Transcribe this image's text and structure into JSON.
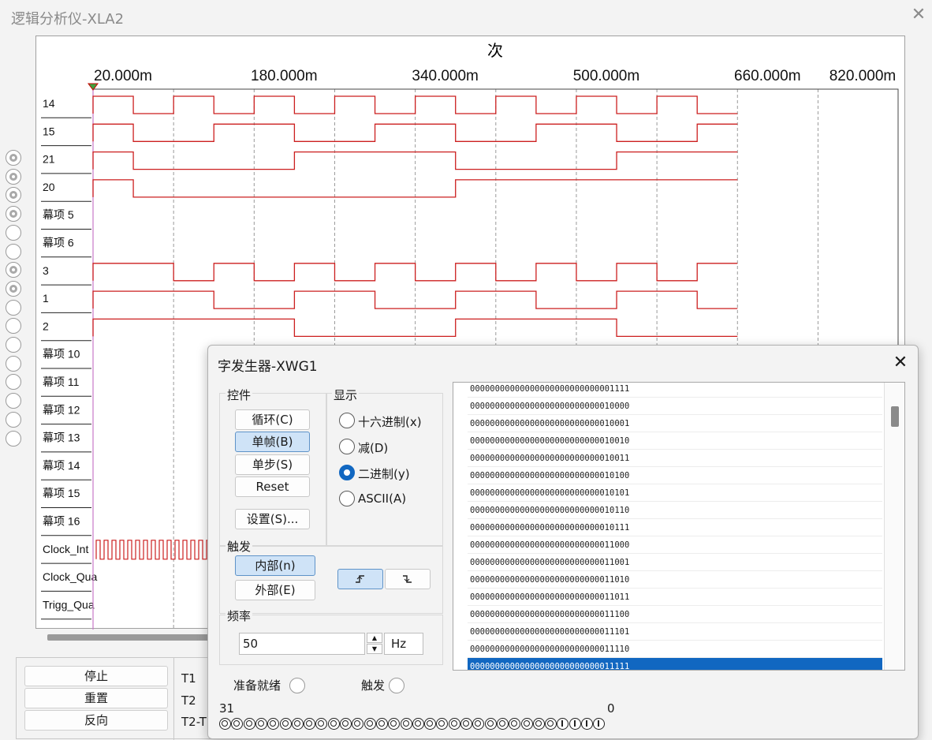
{
  "logic_analyzer": {
    "title": "逻辑分析仪-XLA2",
    "axis_unit": "次",
    "time_ticks": [
      "20.000m",
      "180.000m",
      "340.000m",
      "500.000m",
      "660.000m",
      "820.000m"
    ],
    "channels": [
      "14",
      "15",
      "21",
      "20",
      "幕项 5",
      "幕项 6",
      "3",
      "1",
      "2",
      "幕项 10",
      "幕项 11",
      "幕项 12",
      "幕项 13",
      "幕项 14",
      "幕项 15",
      "幕项 16",
      "Clock_Int",
      "Clock_Qua",
      "Trigg_Qua"
    ],
    "pins_connected": [
      true,
      true,
      true,
      true,
      false,
      false,
      true,
      true,
      false,
      false,
      false,
      false,
      false,
      false,
      false,
      false
    ],
    "trace_color": "#cc1f1f",
    "controls": {
      "stop": "停止",
      "reset": "重置",
      "reverse": "反向"
    },
    "cursor_labels": [
      "T1",
      "T2",
      "T2-T"
    ]
  },
  "word_generator": {
    "title": "字发生器-XWG1",
    "controls": {
      "label": "控件",
      "cycle": "循环(C)",
      "burst": "单帧(B)",
      "step": "单步(S)",
      "reset": "Reset",
      "settings": "设置(S)..."
    },
    "display": {
      "label": "显示",
      "options": [
        "十六进制(x)",
        "减(D)",
        "二进制(y)",
        "ASCII(A)"
      ],
      "selected": 2
    },
    "trigger": {
      "label": "触发",
      "internal": "内部(n)",
      "external": "外部(E)",
      "rising_icon": "rising-edge-icon",
      "falling_icon": "falling-edge-icon"
    },
    "frequency": {
      "label": "频率",
      "value": "50",
      "unit": "Hz"
    },
    "status": {
      "ready": "准备就绪",
      "trigger": "触发"
    },
    "bits": {
      "high_label": "31",
      "low_label": "0",
      "values": "00000000000000000000000000001111"
    },
    "rows": [
      "00000000000000000000000000001111",
      "00000000000000000000000000010000",
      "00000000000000000000000000010001",
      "00000000000000000000000000010010",
      "00000000000000000000000000010011",
      "00000000000000000000000000010100",
      "00000000000000000000000000010101",
      "00000000000000000000000000010110",
      "00000000000000000000000000010111",
      "00000000000000000000000000011000",
      "00000000000000000000000000011001",
      "00000000000000000000000000011010",
      "00000000000000000000000000011011",
      "00000000000000000000000000011100",
      "00000000000000000000000000011101",
      "00000000000000000000000000011110",
      "00000000000000000000000000011111"
    ],
    "selected_row": 16,
    "accent": "#1167c1"
  }
}
